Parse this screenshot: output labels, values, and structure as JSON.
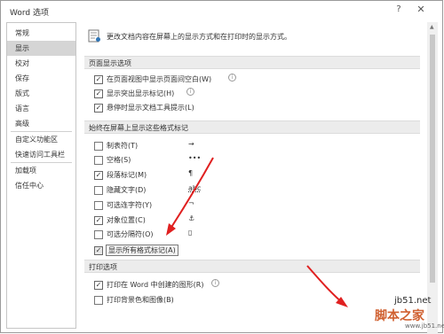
{
  "window": {
    "title": "Word 选项",
    "help": "?",
    "close": "✕"
  },
  "sidebar": {
    "items": [
      {
        "label": "常规"
      },
      {
        "label": "显示",
        "selected": true
      },
      {
        "label": "校对"
      },
      {
        "label": "保存"
      },
      {
        "label": "版式"
      },
      {
        "label": "语言"
      },
      {
        "label": "高级"
      },
      {
        "label": "自定义功能区"
      },
      {
        "label": "快速访问工具栏"
      },
      {
        "label": "加载项"
      },
      {
        "label": "信任中心"
      }
    ]
  },
  "header": {
    "text": "更改文档内容在屏幕上的显示方式和在打印时的显示方式。",
    "icon": "display-settings-icon"
  },
  "sections": {
    "page_display": {
      "title": "页面显示选项",
      "options": [
        {
          "label": "在页面视图中显示页面间空白(W)",
          "checked": true,
          "info": true
        },
        {
          "label": "显示突出显示标记(H)",
          "checked": true,
          "info": true
        },
        {
          "label": "悬停时显示文档工具提示(L)",
          "checked": true,
          "info": false
        }
      ]
    },
    "formatting_marks": {
      "title": "始终在屏幕上显示这些格式标记",
      "options": [
        {
          "label": "制表符(T)",
          "checked": false,
          "symbol": "→"
        },
        {
          "label": "空格(S)",
          "checked": false,
          "symbol": "•••"
        },
        {
          "label": "段落标记(M)",
          "checked": true,
          "symbol": "¶"
        },
        {
          "label": "隐藏文字(D)",
          "checked": false,
          "symbol": "abc"
        },
        {
          "label": "可选连字符(Y)",
          "checked": false,
          "symbol": "¬"
        },
        {
          "label": "对象位置(C)",
          "checked": true,
          "symbol": "⚓"
        },
        {
          "label": "可选分隔符(O)",
          "checked": false,
          "symbol": "▯"
        },
        {
          "label": "显示所有格式标记(A)",
          "checked": true,
          "symbol": ""
        }
      ]
    },
    "print": {
      "title": "打印选项",
      "options": [
        {
          "label": "打印在 Word 中创建的图形(R)",
          "checked": true,
          "info": true
        },
        {
          "label": "打印背景色和图像(B)",
          "checked": false,
          "info": false
        }
      ]
    }
  },
  "watermark": {
    "line1": "jb51.net",
    "line2": "脚本之家",
    "line3": "www.jb51.net"
  },
  "colors": {
    "annotation_arrow": "#e02020",
    "section_bg": "#ececec",
    "selected_nav": "#d5d5d5"
  }
}
